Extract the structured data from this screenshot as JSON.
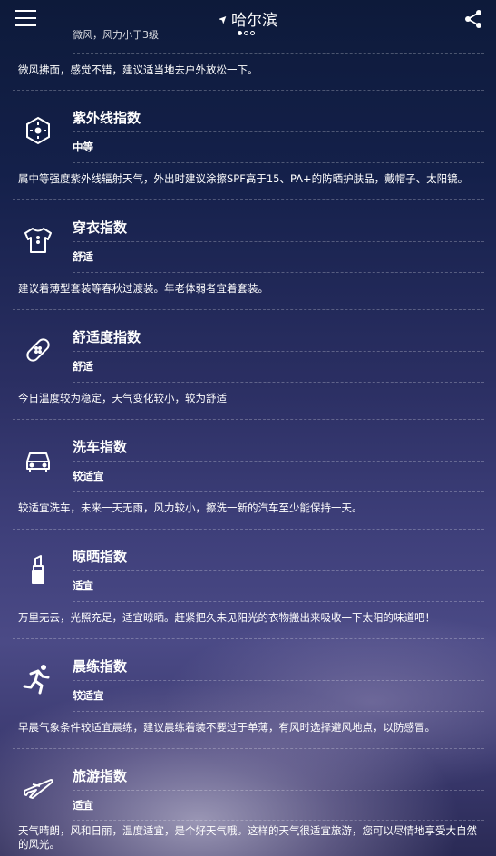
{
  "header": {
    "title": "哈尔滨",
    "page_dots": 3,
    "active_dot": 1
  },
  "top_partial": {
    "level": "微风，风力小于3级",
    "desc": "微风拂面，感觉不错，建议适当地去户外放松一下。"
  },
  "indices": [
    {
      "icon": "sun-uv-icon",
      "title": "紫外线指数",
      "level": "中等",
      "desc": "属中等强度紫外线辐射天气，外出时建议涂擦SPF高于15、PA+的防晒护肤品，戴帽子、太阳镜。"
    },
    {
      "icon": "shirt-icon",
      "title": "穿衣指数",
      "level": "舒适",
      "desc": "建议着薄型套装等春秋过渡装。年老体弱者宜着套装。"
    },
    {
      "icon": "bandage-icon",
      "title": "舒适度指数",
      "level": "舒适",
      "desc": "今日温度较为稳定，天气变化较小，较为舒适"
    },
    {
      "icon": "car-icon",
      "title": "洗车指数",
      "level": "较适宜",
      "desc": "较适宜洗车，未来一天无雨，风力较小，擦洗一新的汽车至少能保持一天。"
    },
    {
      "icon": "lipstick-icon",
      "title": "晾晒指数",
      "level": "适宜",
      "desc": "万里无云，光照充足，适宜晾晒。赶紧把久未见阳光的衣物搬出来吸收一下太阳的味道吧！"
    },
    {
      "icon": "runner-icon",
      "title": "晨练指数",
      "level": "较适宜",
      "desc": "早晨气象条件较适宜晨练，建议晨练着装不要过于单薄，有风时选择避风地点，以防感冒。"
    },
    {
      "icon": "airplane-icon",
      "title": "旅游指数",
      "level": "适宜",
      "desc": "天气晴朗，风和日丽，温度适宜，是个好天气哦。这样的天气很适宜旅游，您可以尽情地享受大自然的风光。"
    }
  ]
}
